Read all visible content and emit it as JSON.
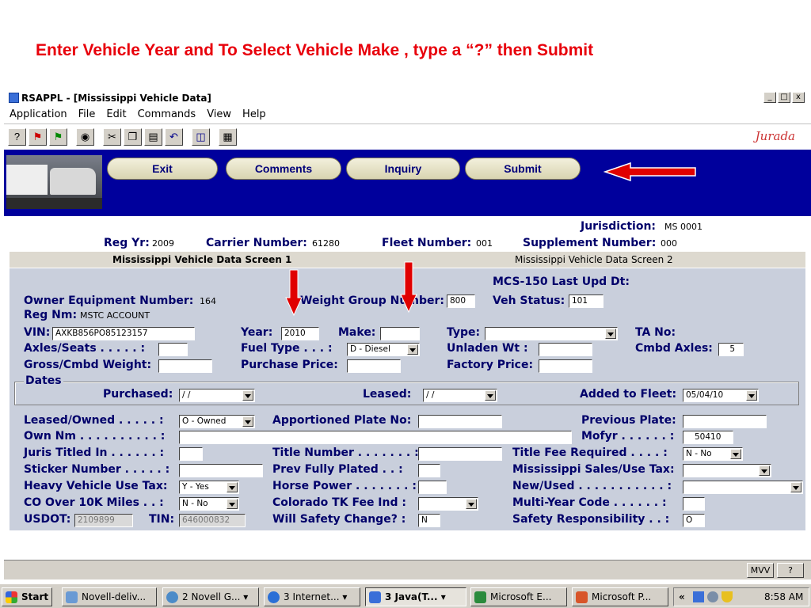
{
  "slide": {
    "title": "Enter Vehicle Year and To Select Vehicle Make , type a “?” then Submit"
  },
  "window": {
    "title": "RSAPPL - [Mississippi Vehicle Data]",
    "min": "_",
    "max": "□",
    "close": "x"
  },
  "menu": [
    "Application",
    "File",
    "Edit",
    "Commands",
    "View",
    "Help"
  ],
  "toolbar_logo": "Jurada",
  "nav": {
    "exit": "Exit",
    "comments": "Comments",
    "inquiry": "Inquiry",
    "submit": "Submit"
  },
  "header": {
    "jurisdiction_label": "Jurisdiction:",
    "jurisdiction_value": "MS 0001",
    "reg_yr_label": "Reg Yr:",
    "reg_yr_value": "2009",
    "carrier_label": "Carrier Number:",
    "carrier_value": "61280",
    "fleet_label": "Fleet Number:",
    "fleet_value": "001",
    "supplement_label": "Supplement Number:",
    "supplement_value": "000"
  },
  "tabs": {
    "screen1": "Mississippi Vehicle Data Screen 1",
    "screen2": "Mississippi Vehicle Data Screen 2"
  },
  "form": {
    "mcs_label": "MCS-150 Last Upd Dt:",
    "owner_equip_label": "Owner Equipment Number:",
    "owner_equip_value": "164",
    "weight_group_label": "Weight Group Number:",
    "weight_group_value": "800",
    "veh_status_label": "Veh Status:",
    "veh_status_value": "101",
    "reg_nm_label": "Reg Nm:",
    "reg_nm_value": "MSTC ACCOUNT",
    "vin_label": "VIN:",
    "vin_value": "AXKB856PO85123157",
    "year_label": "Year:",
    "year_value": "2010",
    "make_label": "Make:",
    "make_value": "",
    "type_label": "Type:",
    "type_value": "",
    "ta_no_label": "TA No:",
    "axles_label": "Axles/Seats . . . . . :",
    "axles_value": "",
    "fuel_label": "Fuel Type . . . :",
    "fuel_value": "D - Diesel",
    "unladen_label": "Unladen Wt :",
    "unladen_value": "",
    "cmbd_axles_label": "Cmbd Axles:",
    "cmbd_axles_value": "5",
    "gross_label": "Gross/Cmbd Weight:",
    "gross_value": "",
    "purchase_price_label": "Purchase Price:",
    "purchase_price_value": "",
    "factory_price_label": "Factory Price:",
    "factory_price_value": "",
    "dates_label": "Dates",
    "purchased_label": "Purchased:",
    "purchased_value": " / /",
    "leased_label": "Leased:",
    "leased_value": " / /",
    "added_fleet_label": "Added to Fleet:",
    "added_fleet_value": "05/04/10",
    "leased_owned_label": "Leased/Owned . . . . . :",
    "leased_owned_value": "O - Owned",
    "apportioned_label": "Apportioned Plate No:",
    "apportioned_value": "",
    "prev_plate_label": "Previous Plate:",
    "prev_plate_value": "",
    "own_nm_label": "Own Nm . . . . . . . . . . :",
    "own_nm_value": "",
    "mofyr_label": "Mofyr . . . . . . :",
    "mofyr_value": "50410",
    "juris_titled_label": "Juris Titled In . . . . . . :",
    "juris_titled_value": "",
    "title_number_label": "Title Number . . . . . . . :",
    "title_number_value": "",
    "title_fee_label": "Title Fee Required . . . . :",
    "title_fee_value": "N - No",
    "sticker_label": "Sticker Number . . . . . :",
    "sticker_value": "",
    "prev_fully_label": "Prev Fully Plated . . :",
    "prev_fully_value": "",
    "ms_sales_label": "Mississippi Sales/Use Tax:",
    "ms_sales_value": "",
    "hvut_label": "Heavy Vehicle Use Tax:",
    "hvut_value": "Y - Yes",
    "horse_power_label": "Horse Power . . . . . . . :",
    "horse_power_value": "",
    "new_used_label": "New/Used . . . . . . . . . . . :",
    "new_used_value": "",
    "co_over_label": "CO Over 10K Miles . . :",
    "co_over_value": "N - No",
    "colorado_label": "Colorado TK Fee Ind :",
    "colorado_value": "",
    "multi_year_label": "Multi-Year Code . . . . . . :",
    "multi_year_value": "",
    "usdot_label": "USDOT:",
    "usdot_value": "2109899",
    "tin_label": "TIN:",
    "tin_value": "646000832",
    "safety_change_label": "Will Safety Change? :",
    "safety_change_value": "N",
    "safety_resp_label": "Safety Responsibility . . :",
    "safety_resp_value": "O"
  },
  "statusbar": {
    "mvv": "MVV",
    "help": "?"
  },
  "taskbar": {
    "start": "Start",
    "tasks": [
      "Novell-deliv...",
      "2 Novell G... ▾",
      "3 Internet... ▾",
      "3 Java(T... ▾",
      "Microsoft E...",
      "Microsoft P..."
    ],
    "tray_chevron": "«",
    "clock": "8:58 AM"
  },
  "colors": {
    "slide_title": "#e8000b",
    "nav_bar": "#00009c",
    "label_text": "#00006a",
    "arrow": "#e00000",
    "panel_bg": "#c9cfdc"
  }
}
